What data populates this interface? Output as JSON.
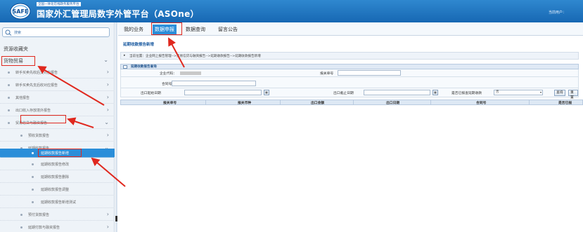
{
  "header": {
    "slogan": "全国一体化在线政务服务平台",
    "title": "国家外汇管理局数字外管平台（ASOne）",
    "user_label": "当前用户：",
    "logo_text": "SAFE"
  },
  "sidebar": {
    "search_label": "搜索",
    "section_favorites": "资源收藏夹",
    "section_goods": "货物贸易",
    "items": [
      {
        "label": "转手买卖先收后支对应报告",
        "expanded": false
      },
      {
        "label": "转手买卖先支后收对应报告",
        "expanded": false
      },
      {
        "label": "其他报告",
        "expanded": false
      },
      {
        "label": "出口收入存放境外报告",
        "expanded": false
      },
      {
        "label": "贸易信贷与融资报告",
        "expanded": true
      },
      {
        "label": "预收货款报告",
        "expanded": false
      },
      {
        "label": "延期收款报告",
        "expanded": true
      },
      {
        "label": "延期收款报告新增",
        "active": true
      },
      {
        "label": "延期收款报告修改"
      },
      {
        "label": "延期收款报告删除"
      },
      {
        "label": "延期收款报告调整"
      },
      {
        "label": "延期收款报告新增测试"
      },
      {
        "label": "预付货款报告",
        "expanded": false
      },
      {
        "label": "延期付款与融资报告",
        "expanded": false
      }
    ]
  },
  "tabs": [
    {
      "label": "我的业务",
      "active": false
    },
    {
      "label": "数据申报",
      "active": true
    },
    {
      "label": "数据查询",
      "active": false
    },
    {
      "label": "留言公告",
      "active": false
    }
  ],
  "page": {
    "title": "延期收款报告新增",
    "breadcrumb": "当前位置：企业网上报告管理-->贸易信贷与融资报告-->延期收款报告-->延期收款报告新增",
    "panel_title": "延期收款报告查询"
  },
  "form": {
    "company_code_label": "企业代码：",
    "customs_no_label": "报关单号",
    "contract_no_label": "合同号",
    "export_start_label": "出口起始日期",
    "export_end_label": "出口截止日期",
    "reported_label": "是否已报查延期收款",
    "reported_value": "否",
    "query_button": "查询",
    "reset_button": "重置",
    "calendar_icon": "calendar-icon"
  },
  "table": {
    "columns": [
      "报关单号",
      "报关币种",
      "出口金额",
      "出口日期",
      "合同号",
      "是否已报"
    ]
  },
  "colors": {
    "header_blue": "#1f76c0",
    "accent_blue": "#2b8ed9",
    "annotation_red": "#e0281e"
  }
}
